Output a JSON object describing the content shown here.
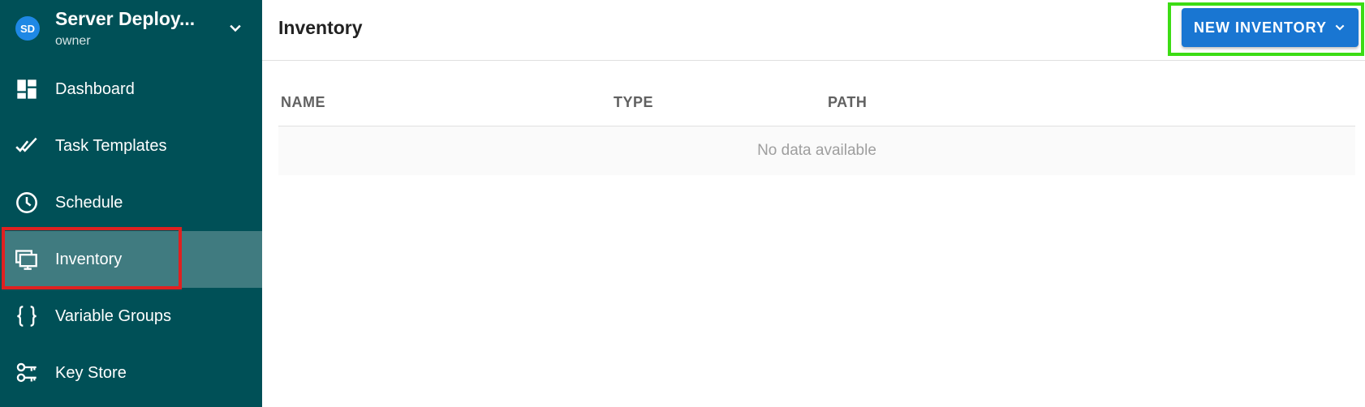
{
  "project": {
    "initials": "SD",
    "name": "Server Deploy...",
    "role": "owner"
  },
  "nav": [
    {
      "label": "Dashboard",
      "icon": "dashboard-icon"
    },
    {
      "label": "Task Templates",
      "icon": "double-check-icon"
    },
    {
      "label": "Schedule",
      "icon": "clock-icon"
    },
    {
      "label": "Inventory",
      "icon": "monitor-icon",
      "active": true
    },
    {
      "label": "Variable Groups",
      "icon": "braces-icon"
    },
    {
      "label": "Key Store",
      "icon": "key-icon"
    }
  ],
  "header": {
    "title": "Inventory",
    "new_button": "NEW INVENTORY"
  },
  "table": {
    "columns": [
      "NAME",
      "TYPE",
      "PATH"
    ],
    "empty_text": "No data available"
  },
  "colors": {
    "sidebar": "#005057",
    "active": "#407b80",
    "accent": "#1976d2"
  }
}
